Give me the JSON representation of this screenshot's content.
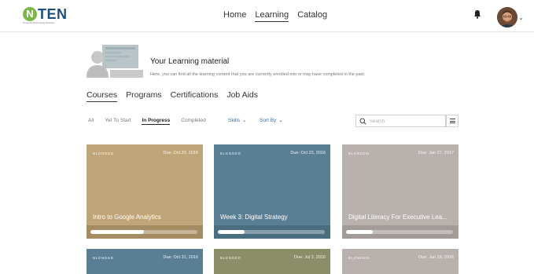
{
  "header": {
    "logo_letter": "N",
    "logo_text": "TEN",
    "logo_tagline": "Nonprofit Technology Network",
    "nav": [
      {
        "label": "Home",
        "active": false
      },
      {
        "label": "Learning",
        "active": true
      },
      {
        "label": "Catalog",
        "active": false
      }
    ],
    "bell_icon": "bell-icon",
    "avatar_icon": "user-avatar",
    "avatar_caret": "⌄"
  },
  "intro": {
    "title": "Your Learning material",
    "description": "Here, you can find all the learning content that you are currently enrolled into or may have completed in the past."
  },
  "tabs": [
    {
      "label": "Courses",
      "active": true
    },
    {
      "label": "Programs",
      "active": false
    },
    {
      "label": "Certifications",
      "active": false
    },
    {
      "label": "Job Aids",
      "active": false
    }
  ],
  "filters": {
    "status": [
      {
        "label": "All",
        "active": false
      },
      {
        "label": "Yet To Start",
        "active": false
      },
      {
        "label": "In Progress",
        "active": true
      },
      {
        "label": "Completed",
        "active": false
      }
    ],
    "skills_label": "Skills",
    "sort_label": "Sort By",
    "caret": "⌄",
    "search_placeholder": "Search"
  },
  "colors": {
    "tan": "#c0a578",
    "steel_blue": "#5a7f94",
    "taupe": "#b9b1ad",
    "olive": "#8b8e68"
  },
  "cards": [
    {
      "type": "BLENDED",
      "due": "Due: Oct 23, 2016",
      "title": "Intro to Google Analytics",
      "progress": 0.5,
      "color": "#c0a578",
      "footer": "#a58c62"
    },
    {
      "type": "BLENDED",
      "due": "Due: Oct 23, 2016",
      "title": "Week 3: Digital Strategy",
      "progress": 0.25,
      "color": "#5a7f94",
      "footer": "#4b6d80"
    },
    {
      "type": "BLENDED",
      "due": "Due: Jan 27, 2017",
      "title": "Digital Literacy For Executive Lea...",
      "progress": 0.25,
      "color": "#b9b1ad",
      "footer": "#a39b97"
    },
    {
      "type": "BLENDED",
      "due": "Due: Oct 31, 2016",
      "title": "",
      "progress": 0,
      "color": "#5a7f94",
      "footer": "#4b6d80"
    },
    {
      "type": "BLENDED",
      "due": "Due: Jul 3, 2016",
      "title": "",
      "progress": 0,
      "color": "#8b8e68",
      "footer": "#777a58"
    },
    {
      "type": "BLENDED",
      "due": "Due: Jun 19, 2016",
      "title": "",
      "progress": 0,
      "color": "#b9b1ad",
      "footer": "#a39b97"
    }
  ]
}
